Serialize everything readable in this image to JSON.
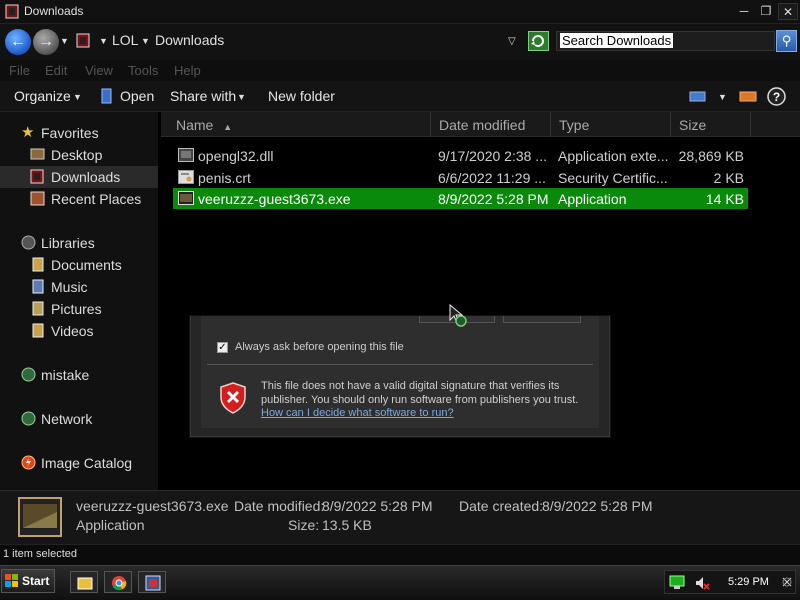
{
  "window": {
    "title": "Downloads",
    "minimize": "─",
    "maximize": "❐",
    "close": "✕"
  },
  "address": {
    "back": "←",
    "forward": "→",
    "crumbs": [
      "LOL",
      "Downloads"
    ],
    "search_text": "Search Downloads",
    "search_glyph": "⚲"
  },
  "menu": [
    "File",
    "Edit",
    "View",
    "Tools",
    "Help"
  ],
  "commands": {
    "organize": "Organize",
    "open": "Open",
    "share": "Share with",
    "new_folder": "New folder"
  },
  "nav": {
    "favorites": "Favorites",
    "desktop": "Desktop",
    "downloads": "Downloads",
    "recent": "Recent Places",
    "libraries": "Libraries",
    "documents": "Documents",
    "music": "Music",
    "pictures": "Pictures",
    "videos": "Videos",
    "mistake": "mistake",
    "network": "Network",
    "image_catalog": "Image Catalog"
  },
  "columns": [
    "Name",
    "Date modified",
    "Type",
    "Size"
  ],
  "files": [
    {
      "name": "opengl32.dll",
      "date": "9/17/2020 2:38 ...",
      "type": "Application exte...",
      "size": "28,869 KB"
    },
    {
      "name": "penis.crt",
      "date": "6/6/2022 11:29 ...",
      "type": "Security Certific...",
      "size": "2 KB"
    },
    {
      "name": "veeruzzz-guest3673.exe",
      "date": "8/9/2022 5:28 PM",
      "type": "Application",
      "size": "14 KB"
    }
  ],
  "dialog": {
    "checkbox_mark": "✓",
    "checkbox_label": "Always ask before opening this file",
    "warning_line1": "This file does not have a valid digital signature that verifies its",
    "warning_line2": "publisher.  You should only run software from publishers you trust.",
    "warning_link": "How can I decide what software to run?"
  },
  "details": {
    "name": "veeruzzz-guest3673.exe",
    "type": "Application",
    "date_modified_label": "Date modified:",
    "date_modified": "8/9/2022 5:28 PM",
    "date_created_label": "Date created:",
    "date_created": "8/9/2022 5:28 PM",
    "size_label": "Size:",
    "size": "13.5 KB"
  },
  "status": "1 item selected",
  "taskbar": {
    "start": "Start",
    "clock": "5:29 PM"
  },
  "colors": {
    "selection": "#0a8a0a",
    "background": "#000000",
    "accent_blue": "#2a5ba8"
  }
}
